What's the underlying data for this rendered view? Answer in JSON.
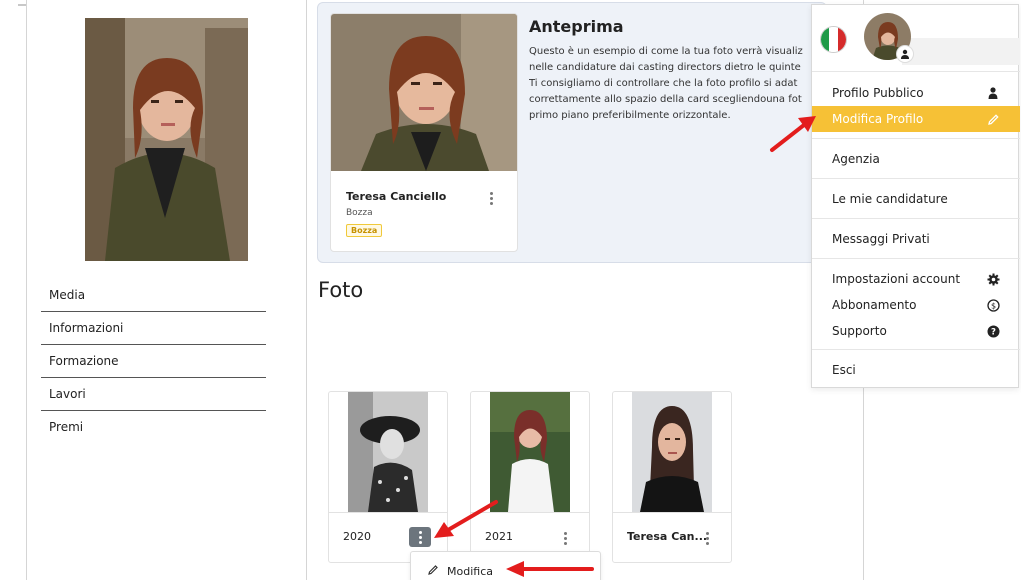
{
  "colors": {
    "accent": "#f6c136",
    "arrow": "#e31d1d",
    "badge_text": "#c79200",
    "preview_bg": "#eef2f8"
  },
  "sidebar": {
    "items": [
      {
        "label": "Media"
      },
      {
        "label": "Informazioni"
      },
      {
        "label": "Formazione"
      },
      {
        "label": "Lavori"
      },
      {
        "label": "Premi"
      }
    ]
  },
  "preview": {
    "title": "Anteprima",
    "text_lines": [
      "Questo è un esempio di come la tua foto verrà visualiz",
      "nelle candidature dai casting directors dietro le quinte",
      "Ti consigliamo di controllare che la foto profilo si adat",
      "correttamente allo spazio della card scegliendouna fot",
      "primo piano preferibilmente orizzontale."
    ],
    "card": {
      "name": "Teresa Canciello",
      "status": "Bozza",
      "badge": "Bozza"
    }
  },
  "photos": {
    "heading": "Foto",
    "cards": [
      {
        "label": "2020"
      },
      {
        "label": "2021"
      },
      {
        "label": "Teresa Can..."
      }
    ],
    "context_menu": {
      "edit_label": "Modifica",
      "edit_icon": "pencil-icon"
    }
  },
  "dropdown": {
    "flag": "italy-flag",
    "items": [
      {
        "label": "Profilo Pubblico",
        "icon": "user-icon"
      },
      {
        "label": "Modifica Profilo",
        "icon": "pencil-icon",
        "active": true
      },
      {
        "label": "Agenzia"
      },
      {
        "label": "Le mie candidature"
      },
      {
        "label": "Messaggi Privati"
      },
      {
        "label": "Impostazioni account",
        "icon": "gear-icon"
      },
      {
        "label": "Abbonamento",
        "icon": "dollar-icon"
      },
      {
        "label": "Supporto",
        "icon": "question-icon"
      },
      {
        "label": "Esci"
      }
    ]
  }
}
